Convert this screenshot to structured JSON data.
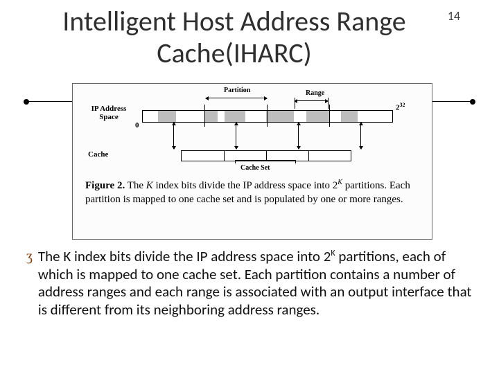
{
  "page_number": "14",
  "title": "Intelligent Host Address Range Cache(IHARC)",
  "figure": {
    "ip_label": "IP Address Space",
    "cache_label": "Cache",
    "zero": "0",
    "end_base": "2",
    "end_exp": "32",
    "partition_label": "Partition",
    "range_label": "Range",
    "cache_set_label": "Cache Set",
    "caption_label": "Figure 2.",
    "caption_before": " The ",
    "caption_k": "K",
    "caption_mid": " index bits divide the IP address space into 2",
    "caption_exp": "K",
    "caption_after": " partitions. Each partition is mapped to one cache set and is populated by one or more ranges."
  },
  "body": {
    "bullet_glyph": "ʒ",
    "t1": "The K index bits divide the IP address space into 2",
    "exp": "K",
    "t2": " partitions, each of which is mapped to one cache set. Each partition contains a number of address ranges and each range is associated with an output interface that is different from its neighboring address ranges."
  }
}
